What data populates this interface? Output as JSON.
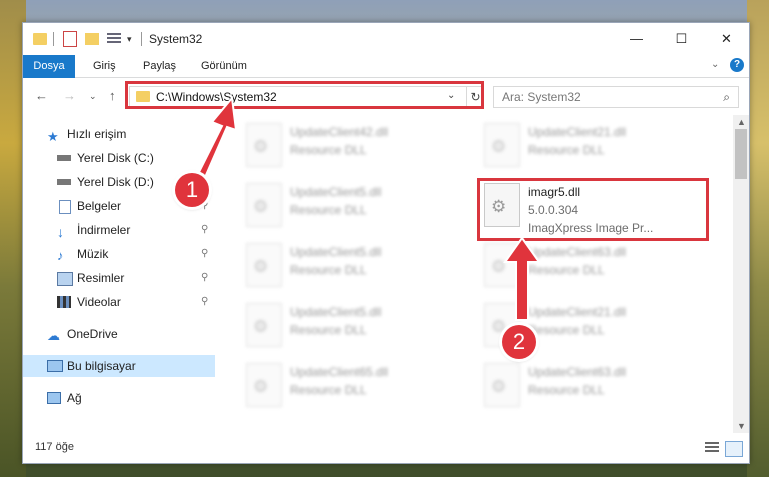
{
  "window": {
    "title": "System32",
    "min_glyph": "—",
    "max_glyph": "☐",
    "close_glyph": "✕"
  },
  "ribbon": {
    "tabs": [
      "Dosya",
      "Giriş",
      "Paylaş",
      "Görünüm"
    ],
    "chevron": "⌄",
    "help": "?"
  },
  "nav": {
    "back": "←",
    "forward": "→",
    "recent": "⌄",
    "up": "↑",
    "address": "C:\\Windows\\System32",
    "address_drop": "⌄",
    "refresh": "↻",
    "search_placeholder": "Ara: System32",
    "search_glyph": "⌕"
  },
  "sidebar": {
    "items": [
      {
        "label": "Hızlı erişim",
        "icon": "star-icon"
      },
      {
        "label": "Yerel Disk (C:)",
        "icon": "drive-icon"
      },
      {
        "label": "Yerel Disk (D:)",
        "icon": "drive-icon"
      },
      {
        "label": "Belgeler",
        "icon": "documents-icon",
        "pinned": true
      },
      {
        "label": "İndirmeler",
        "icon": "download-icon",
        "pinned": true
      },
      {
        "label": "Müzik",
        "icon": "music-icon",
        "pinned": true
      },
      {
        "label": "Resimler",
        "icon": "pictures-icon",
        "pinned": true
      },
      {
        "label": "Videolar",
        "icon": "videos-icon",
        "pinned": true
      },
      {
        "label": "OneDrive",
        "icon": "cloud-icon"
      },
      {
        "label": "Bu bilgisayar",
        "icon": "computer-icon",
        "selected": true
      },
      {
        "label": "Ağ",
        "icon": "network-icon"
      }
    ],
    "pin_glyph": "📌"
  },
  "files": {
    "left_column": [
      {
        "name": "UpdateClient42.dll",
        "type": "Resource DLL"
      },
      {
        "name": "UpdateClient5.dll",
        "type": "Resource DLL"
      },
      {
        "name": "UpdateClient5.dll",
        "type": "Resource DLL"
      },
      {
        "name": "UpdateClient5.dll",
        "type": "Resource DLL"
      },
      {
        "name": "UpdateClient65.dll",
        "type": "Resource DLL"
      }
    ],
    "right_column": [
      {
        "name": "UpdateClient21.dll",
        "type": "Resource DLL"
      },
      {
        "name": "imagr5.dll",
        "version": "5.0.0.304",
        "description": "ImagXpress Image Pr..."
      },
      {
        "name": "UpdateClient63.dll",
        "type": "Resource DLL"
      },
      {
        "name": "UpdateClient21.dll",
        "type": "Resource DLL"
      },
      {
        "name": "UpdateClient63.dll",
        "type": "Resource DLL"
      }
    ]
  },
  "status": {
    "count": "117 öğe"
  },
  "annotations": {
    "badge1": "1",
    "badge2": "2",
    "color": "#e0343c"
  }
}
